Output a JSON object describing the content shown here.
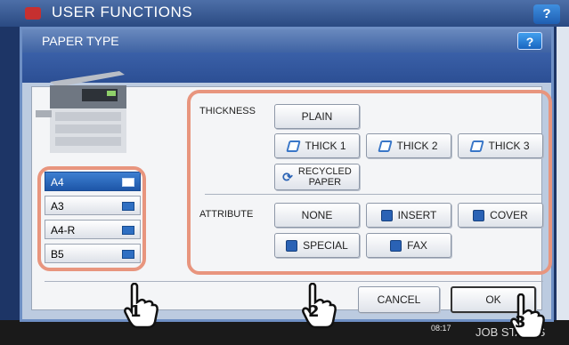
{
  "background": {
    "title": "USER FUNCTIONS",
    "help_label": "?",
    "clock_line1": "",
    "clock_line2": "08:17",
    "job_status": "JOB STATUS"
  },
  "dialog": {
    "title": "PAPER TYPE",
    "help_label": "?"
  },
  "paper_sizes": [
    {
      "label": "A4",
      "selected": true
    },
    {
      "label": "A3",
      "selected": false
    },
    {
      "label": "A4-R",
      "selected": false
    },
    {
      "label": "B5",
      "selected": false
    }
  ],
  "thickness": {
    "label": "THICKNESS",
    "plain": "PLAIN",
    "thick1": "THICK 1",
    "thick2": "THICK 2",
    "thick3": "THICK 3",
    "recycled_line1": "RECYCLED",
    "recycled_line2": "PAPER"
  },
  "attribute": {
    "label": "ATTRIBUTE",
    "none": "NONE",
    "insert": "INSERT",
    "cover": "COVER",
    "special": "SPECIAL",
    "fax": "FAX"
  },
  "footer": {
    "cancel": "CANCEL",
    "ok": "OK"
  },
  "callouts": {
    "step1": "1",
    "step2": "2",
    "step3": "3"
  },
  "colors": {
    "callout": "#e8957e",
    "accent": "#2a62b5",
    "selected": "#1d56a8"
  },
  "icons": {
    "thick": "paper-thickness-icon",
    "recycle": "recycle-icon",
    "attribute": "attribute-icon",
    "tray": "paper-tray-icon",
    "hand": "pointing-hand-icon"
  }
}
